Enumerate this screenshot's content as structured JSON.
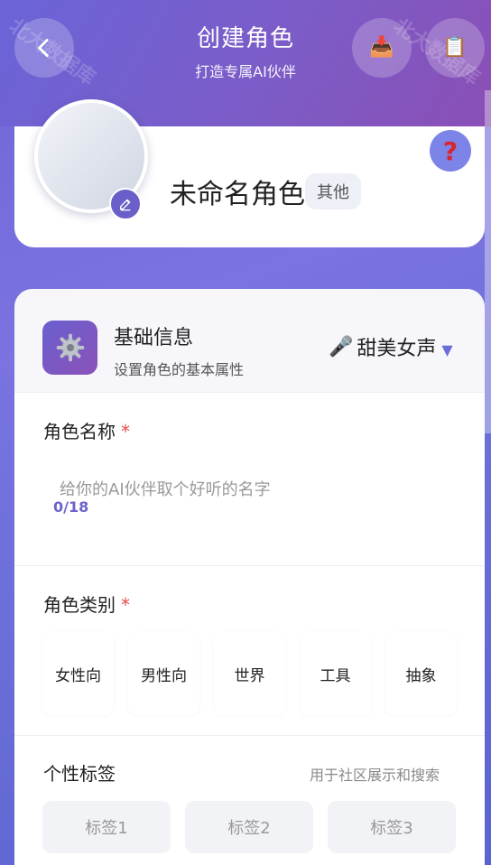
{
  "header": {
    "title": "创建角色",
    "subtitle": "打造专属AI伙伴",
    "watermark": "北大数据库"
  },
  "profile": {
    "name": "未命名角色",
    "category_badge": "其他",
    "help_glyph": "?"
  },
  "basic_section": {
    "title": "基础信息",
    "subtitle": "设置角色的基本属性",
    "voice": "甜美女声"
  },
  "name_field": {
    "label": "角色名称",
    "required_mark": "*",
    "placeholder": "给你的AI伙伴取个好听的名字",
    "counter": "0/18"
  },
  "category_field": {
    "label": "角色类别",
    "required_mark": "*",
    "options": [
      "女性向",
      "男性向",
      "世界",
      "工具",
      "抽象"
    ]
  },
  "tags_field": {
    "label": "个性标签",
    "hint": "用于社区展示和搜索",
    "tags": [
      "标签1",
      "标签2",
      "标签3"
    ]
  },
  "icons": {
    "back": "chevron-left-icon",
    "action1": "inbox-tray-icon",
    "action2": "clipboard-icon",
    "avatar_edit": "pencil-icon",
    "help": "question-mark-icon",
    "section": "gear-icon",
    "voice": "microphone-icon",
    "dropdown": "caret-down-icon"
  },
  "colors": {
    "accent": "#6a5fc8",
    "required": "#e64b4b",
    "help_bg": "#7c84e8"
  }
}
